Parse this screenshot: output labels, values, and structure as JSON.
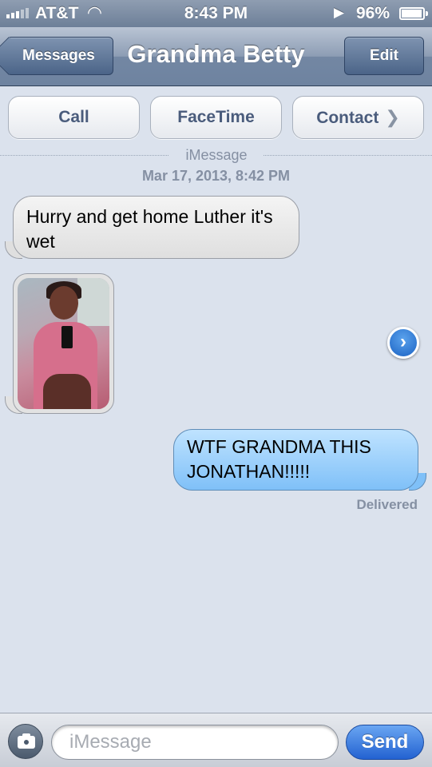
{
  "status_bar": {
    "carrier": "AT&T",
    "time": "8:43 PM",
    "battery": "96%",
    "battery_level": 0.96
  },
  "nav": {
    "back_label": "Messages",
    "title": "Grandma Betty",
    "edit_label": "Edit"
  },
  "actions": {
    "call": "Call",
    "facetime": "FaceTime",
    "contact": "Contact"
  },
  "thread": {
    "service_label": "iMessage",
    "timestamp": "Mar 17, 2013, 8:42 PM",
    "messages": [
      {
        "direction": "incoming",
        "text": "Hurry and get home Luther it's wet"
      },
      {
        "direction": "incoming",
        "type": "photo"
      },
      {
        "direction": "outgoing",
        "text": "WTF GRANDMA THIS JONATHAN!!!!!"
      }
    ],
    "delivered_label": "Delivered"
  },
  "composer": {
    "placeholder": "iMessage",
    "send_label": "Send"
  },
  "colors": {
    "incoming_bubble": "#e8e8e8",
    "outgoing_bubble": "#9fd0fb",
    "nav_bar": "#7a8ca8",
    "send_button": "#2f6fd8"
  },
  "icons": [
    "signal-icon",
    "wifi-icon",
    "location-arrow-icon",
    "battery-icon",
    "chevron-right-icon",
    "camera-icon",
    "disclosure-arrow-icon"
  ]
}
